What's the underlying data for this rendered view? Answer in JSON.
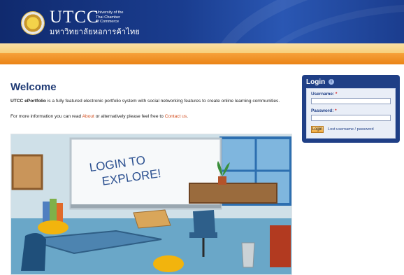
{
  "header": {
    "logo_text": "UTCC",
    "university_name_en": "University of the Thai Chamber of Commerce",
    "university_name_th": "มหาวิทยาลัยหอการค้าไทย"
  },
  "main": {
    "title": "Welcome",
    "intro_bold": "UTCC ePortfolio",
    "intro_rest": "is a fully featured electronic portfolio system with social networking features to create online learning communities.",
    "more_prefix": "For more information you can read",
    "about_link": "About",
    "more_middle": "or alternatively please feel free to",
    "contact_link": "Contact us",
    "more_suffix": ".",
    "illustration_text": "LOGIN TO EXPLORE!"
  },
  "login": {
    "title": "Login",
    "username_label": "Username:",
    "password_label": "Password:",
    "required_mark": "*",
    "username_value": "",
    "password_value": "",
    "button_label": "Login",
    "lost_link": "Lost username / password"
  }
}
